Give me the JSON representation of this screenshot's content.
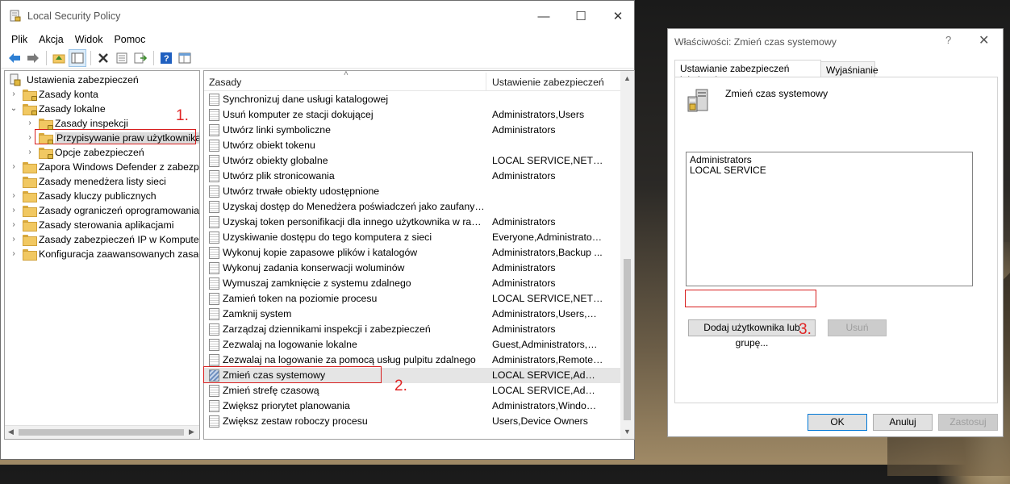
{
  "main_window": {
    "title": "Local Security Policy",
    "menu": [
      "Plik",
      "Akcja",
      "Widok",
      "Pomoc"
    ]
  },
  "tree": {
    "root": "Ustawienia zabezpieczeń",
    "items": [
      {
        "label": "Zasady konta",
        "indent": 1
      },
      {
        "label": "Zasady lokalne",
        "indent": 1
      },
      {
        "label": "Zasady inspekcji",
        "indent": 2
      },
      {
        "label": "Przypisywanie praw użytkownika",
        "indent": 2
      },
      {
        "label": "Opcje zabezpieczeń",
        "indent": 2
      },
      {
        "label": "Zapora Windows Defender z zabezpie",
        "indent": 1
      },
      {
        "label": "Zasady menedżera listy sieci",
        "indent": 1
      },
      {
        "label": "Zasady kluczy publicznych",
        "indent": 1
      },
      {
        "label": "Zasady ograniczeń oprogramowania",
        "indent": 1
      },
      {
        "label": "Zasady sterowania aplikacjami",
        "indent": 1
      },
      {
        "label": "Zasady zabezpieczeń IP w Komputer l",
        "indent": 1
      },
      {
        "label": "Konfiguracja zaawansowanych zasad",
        "indent": 1
      }
    ]
  },
  "list": {
    "col_policy": "Zasady",
    "col_setting": "Ustawienie zabezpieczeń",
    "rows": [
      {
        "name": "Synchronizuj dane usługi katalogowej",
        "value": ""
      },
      {
        "name": "Usuń komputer ze stacji dokującej",
        "value": "Administrators,Users"
      },
      {
        "name": "Utwórz linki symboliczne",
        "value": "Administrators"
      },
      {
        "name": "Utwórz obiekt tokenu",
        "value": ""
      },
      {
        "name": "Utwórz obiekty globalne",
        "value": "LOCAL SERVICE,NETWO..."
      },
      {
        "name": "Utwórz plik stronicowania",
        "value": "Administrators"
      },
      {
        "name": "Utwórz trwałe obiekty udostępnione",
        "value": ""
      },
      {
        "name": "Uzyskaj dostęp do Menedżera poświadczeń jako zaufany obi...",
        "value": ""
      },
      {
        "name": "Uzyskaj token personifikacji dla innego użytkownika w rama...",
        "value": "Administrators"
      },
      {
        "name": "Uzyskiwanie dostępu do tego komputera z sieci",
        "value": "Everyone,Administrators..."
      },
      {
        "name": "Wykonuj kopie zapasowe plików i katalogów",
        "value": "Administrators,Backup ..."
      },
      {
        "name": "Wykonuj zadania konserwacji woluminów",
        "value": "Administrators"
      },
      {
        "name": "Wymuszaj zamknięcie z systemu zdalnego",
        "value": "Administrators"
      },
      {
        "name": "Zamień token na poziomie procesu",
        "value": "LOCAL SERVICE,NETWO..."
      },
      {
        "name": "Zamknij system",
        "value": "Administrators,Users,Ba..."
      },
      {
        "name": "Zarządzaj dziennikami inspekcji i zabezpieczeń",
        "value": "Administrators"
      },
      {
        "name": "Zezwalaj na logowanie lokalne",
        "value": "Guest,Administrators,Us..."
      },
      {
        "name": "Zezwalaj na logowanie za pomocą usług pulpitu zdalnego",
        "value": "Administrators,Remote ..."
      },
      {
        "name": "Zmień czas systemowy",
        "value": "LOCAL SERVICE,Admini..."
      },
      {
        "name": "Zmień strefę czasową",
        "value": "LOCAL SERVICE,Admini..."
      },
      {
        "name": "Zwiększ priorytet planowania",
        "value": "Administrators,Window ..."
      },
      {
        "name": "Zwiększ zestaw roboczy procesu",
        "value": "Users,Device Owners"
      }
    ],
    "selected_index": 18
  },
  "annotations": {
    "step1": "1.",
    "step2": "2.",
    "step3": "3."
  },
  "dialog": {
    "title": "Właściwości: Zmień czas systemowy",
    "help": "?",
    "tab_local": "Ustawianie zabezpieczeń lokalnych",
    "tab_explain": "Wyjaśnianie",
    "policy_name": "Zmień czas systemowy",
    "members": [
      "Administrators",
      "LOCAL SERVICE"
    ],
    "add_button": "Dodaj użytkownika lub grupę...",
    "remove_button": "Usuń",
    "ok_button": "OK",
    "cancel_button": "Anuluj",
    "apply_button": "Zastosuj"
  },
  "colors": {
    "highlight": "#d81e1e",
    "step_text": "#e02424"
  }
}
